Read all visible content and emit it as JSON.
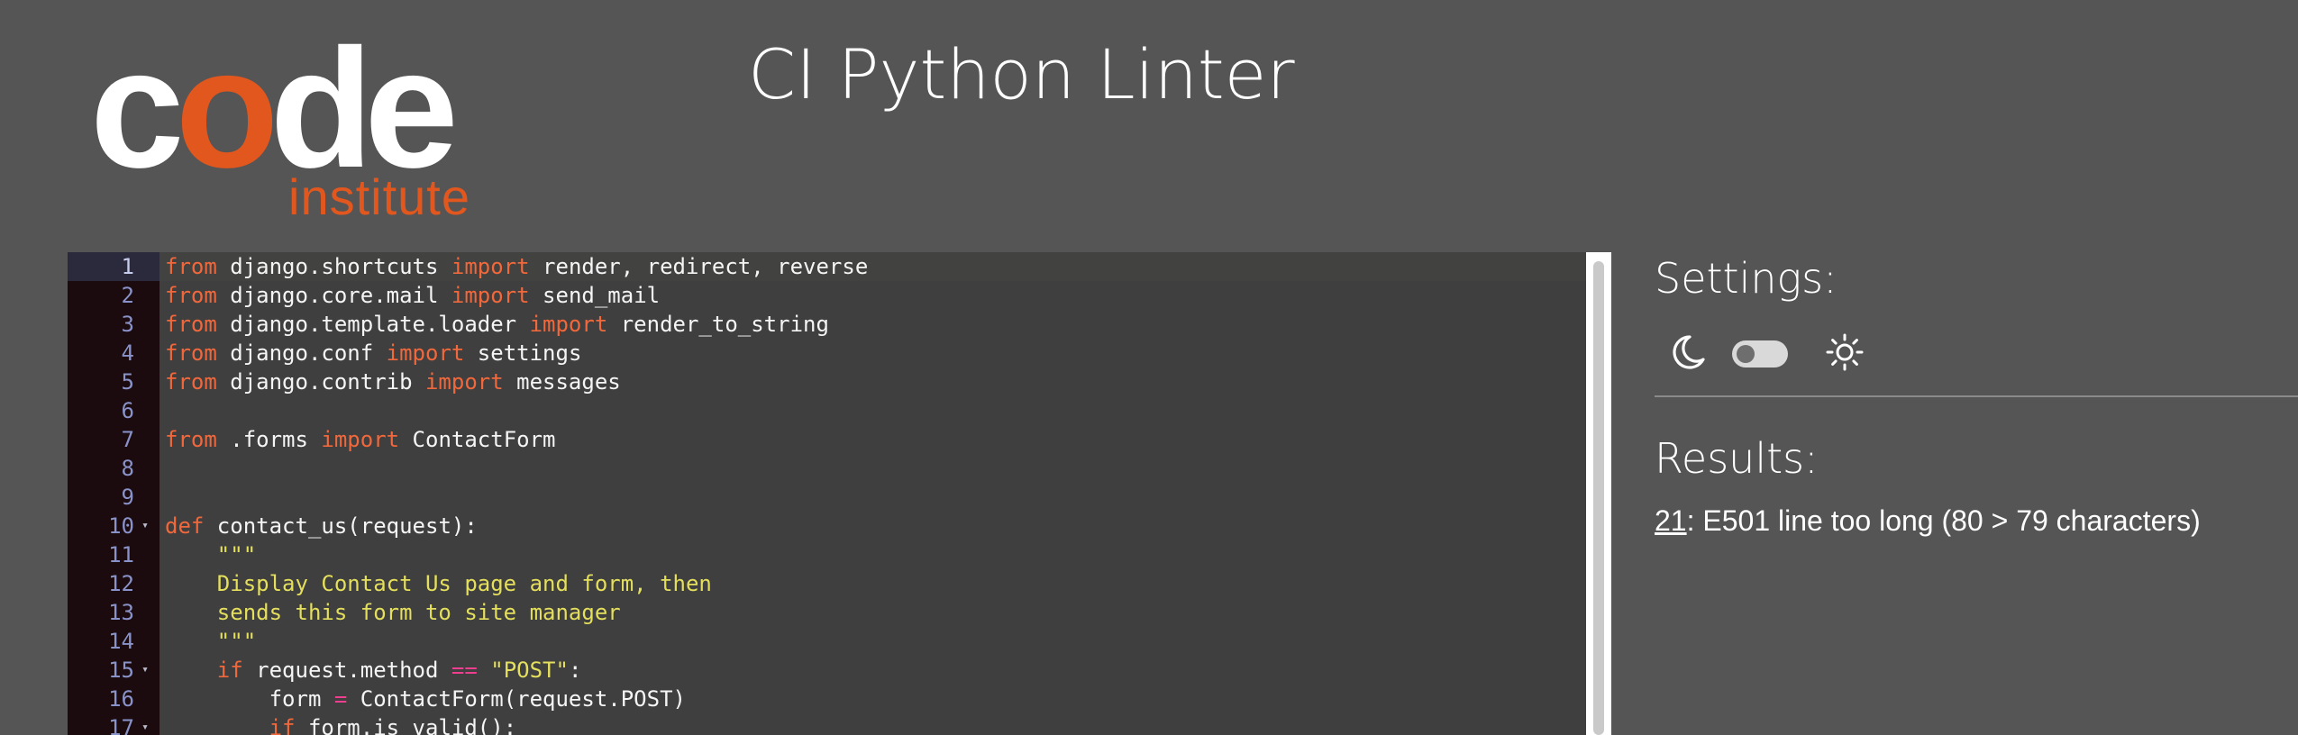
{
  "logo": {
    "word_c": "c",
    "word_o": "o",
    "word_de": "de",
    "sub": "institute"
  },
  "title": "CI Python Linter",
  "editor": {
    "active_line": 1,
    "lines": [
      {
        "n": "1",
        "fold": false,
        "tokens": [
          {
            "t": "from",
            "c": "kw"
          },
          {
            "t": " django.shortcuts ",
            "c": ""
          },
          {
            "t": "import",
            "c": "kw"
          },
          {
            "t": " render, redirect, reverse",
            "c": ""
          }
        ]
      },
      {
        "n": "2",
        "fold": false,
        "tokens": [
          {
            "t": "from",
            "c": "kw"
          },
          {
            "t": " django.core.mail ",
            "c": ""
          },
          {
            "t": "import",
            "c": "kw"
          },
          {
            "t": " send_mail",
            "c": ""
          }
        ]
      },
      {
        "n": "3",
        "fold": false,
        "tokens": [
          {
            "t": "from",
            "c": "kw"
          },
          {
            "t": " django.template.loader ",
            "c": ""
          },
          {
            "t": "import",
            "c": "kw"
          },
          {
            "t": " render_to_string",
            "c": ""
          }
        ]
      },
      {
        "n": "4",
        "fold": false,
        "tokens": [
          {
            "t": "from",
            "c": "kw"
          },
          {
            "t": " django.conf ",
            "c": ""
          },
          {
            "t": "import",
            "c": "kw"
          },
          {
            "t": " settings",
            "c": ""
          }
        ]
      },
      {
        "n": "5",
        "fold": false,
        "tokens": [
          {
            "t": "from",
            "c": "kw"
          },
          {
            "t": " django.contrib ",
            "c": ""
          },
          {
            "t": "import",
            "c": "kw"
          },
          {
            "t": " messages",
            "c": ""
          }
        ]
      },
      {
        "n": "6",
        "fold": false,
        "tokens": []
      },
      {
        "n": "7",
        "fold": false,
        "tokens": [
          {
            "t": "from",
            "c": "kw"
          },
          {
            "t": " .forms ",
            "c": ""
          },
          {
            "t": "import",
            "c": "kw"
          },
          {
            "t": " ContactForm",
            "c": ""
          }
        ]
      },
      {
        "n": "8",
        "fold": false,
        "tokens": []
      },
      {
        "n": "9",
        "fold": false,
        "tokens": []
      },
      {
        "n": "10",
        "fold": true,
        "tokens": [
          {
            "t": "def",
            "c": "kw"
          },
          {
            "t": " contact_us(request):",
            "c": ""
          }
        ]
      },
      {
        "n": "11",
        "fold": false,
        "tokens": [
          {
            "t": "    \"\"\"",
            "c": "str"
          }
        ]
      },
      {
        "n": "12",
        "fold": false,
        "tokens": [
          {
            "t": "    Display Contact Us page and form, then",
            "c": "str"
          }
        ]
      },
      {
        "n": "13",
        "fold": false,
        "tokens": [
          {
            "t": "    sends this form to site manager",
            "c": "str"
          }
        ]
      },
      {
        "n": "14",
        "fold": false,
        "tokens": [
          {
            "t": "    \"\"\"",
            "c": "str"
          }
        ]
      },
      {
        "n": "15",
        "fold": true,
        "tokens": [
          {
            "t": "    ",
            "c": ""
          },
          {
            "t": "if",
            "c": "kw"
          },
          {
            "t": " request.method ",
            "c": ""
          },
          {
            "t": "==",
            "c": "op"
          },
          {
            "t": " ",
            "c": ""
          },
          {
            "t": "\"POST\"",
            "c": "str"
          },
          {
            "t": ":",
            "c": ""
          }
        ]
      },
      {
        "n": "16",
        "fold": false,
        "tokens": [
          {
            "t": "        form ",
            "c": ""
          },
          {
            "t": "=",
            "c": "op"
          },
          {
            "t": " ContactForm(request.POST)",
            "c": ""
          }
        ]
      },
      {
        "n": "17",
        "fold": true,
        "tokens": [
          {
            "t": "        ",
            "c": ""
          },
          {
            "t": "if",
            "c": "kw"
          },
          {
            "t": " form.is_valid():",
            "c": ""
          }
        ]
      }
    ]
  },
  "settings": {
    "heading": "Settings:",
    "moon_icon": "moon-icon",
    "sun_icon": "sun-icon",
    "dark_mode": false
  },
  "results": {
    "heading": "Results:",
    "items": [
      {
        "line": "21",
        "message": ": E501 line too long (80 > 79 characters)"
      }
    ]
  },
  "colors": {
    "background": "#555555",
    "brand_orange": "#e2571e",
    "keyword": "#f0683b",
    "operator": "#ee3e8f",
    "string": "#e4df5c",
    "gutter_bg": "#1b0b0e",
    "line_number": "#8a93c9"
  }
}
